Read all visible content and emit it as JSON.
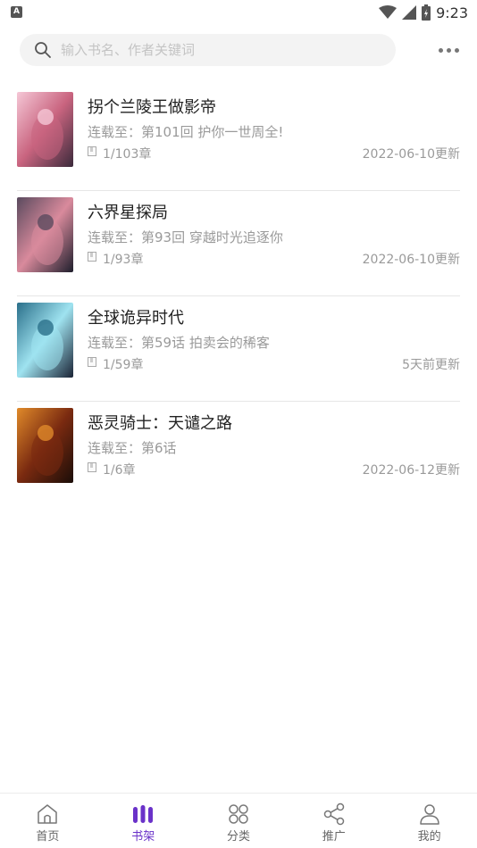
{
  "status_bar": {
    "time": "9:23",
    "app_badge": "A"
  },
  "search": {
    "placeholder": "输入书名、作者关键词",
    "value": ""
  },
  "books": [
    {
      "title": "拐个兰陵王做影帝",
      "latest": "连载至：第101回 护你一世周全!",
      "progress": "1/103章",
      "updated": "2022-06-10更新",
      "cover_colors": [
        "#f5c7d6",
        "#c9647f",
        "#3b2a3b"
      ]
    },
    {
      "title": "六界星探局",
      "latest": "连载至：第93回 穿越时光追逐你",
      "progress": "1/93章",
      "updated": "2022-06-10更新",
      "cover_colors": [
        "#5a4a5e",
        "#d98a9c",
        "#1e1e2c"
      ]
    },
    {
      "title": "全球诡异时代",
      "latest": "连载至：第59话 拍卖会的稀客",
      "progress": "1/59章",
      "updated": "5天前更新",
      "cover_colors": [
        "#2a6f8a",
        "#9fe3f0",
        "#1a2335"
      ]
    },
    {
      "title": "恶灵骑士：天谴之路",
      "latest": "连载至：第6话",
      "progress": "1/6章",
      "updated": "2022-06-12更新",
      "cover_colors": [
        "#e08a2a",
        "#7a2a10",
        "#1a0d08"
      ]
    }
  ],
  "bottom_nav": [
    {
      "label": "首页",
      "icon": "home-icon",
      "active": false
    },
    {
      "label": "书架",
      "icon": "bookshelf-icon",
      "active": true
    },
    {
      "label": "分类",
      "icon": "category-icon",
      "active": false
    },
    {
      "label": "推广",
      "icon": "share-icon",
      "active": false
    },
    {
      "label": "我的",
      "icon": "profile-icon",
      "active": false
    }
  ],
  "colors": {
    "accent": "#6a32c9",
    "muted_text": "#9a9a9a",
    "search_bg": "#f3f3f3"
  }
}
